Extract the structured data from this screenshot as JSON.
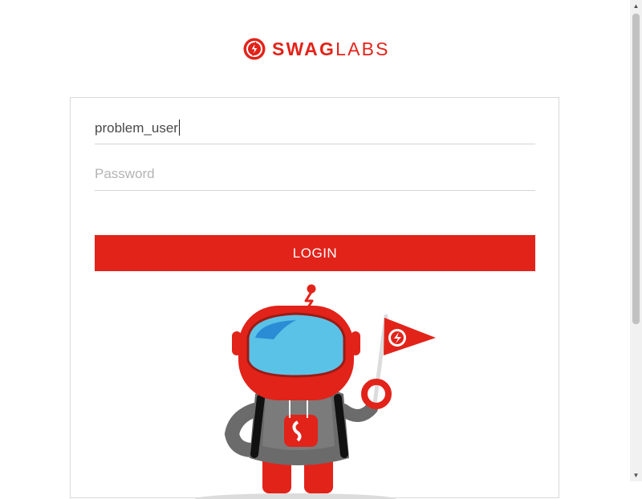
{
  "brand": {
    "name_bold": "SWAG",
    "name_light": "LABS",
    "color": "#e2231a"
  },
  "login": {
    "username_value": "problem_user",
    "password_placeholder": "Password",
    "button_label": "LOGIN"
  },
  "icons": {
    "logo": "bolt-circle-icon",
    "mascot": "swag-bot-mascot",
    "scroll_up": "triangle-up-icon",
    "scroll_down": "triangle-down-icon"
  }
}
